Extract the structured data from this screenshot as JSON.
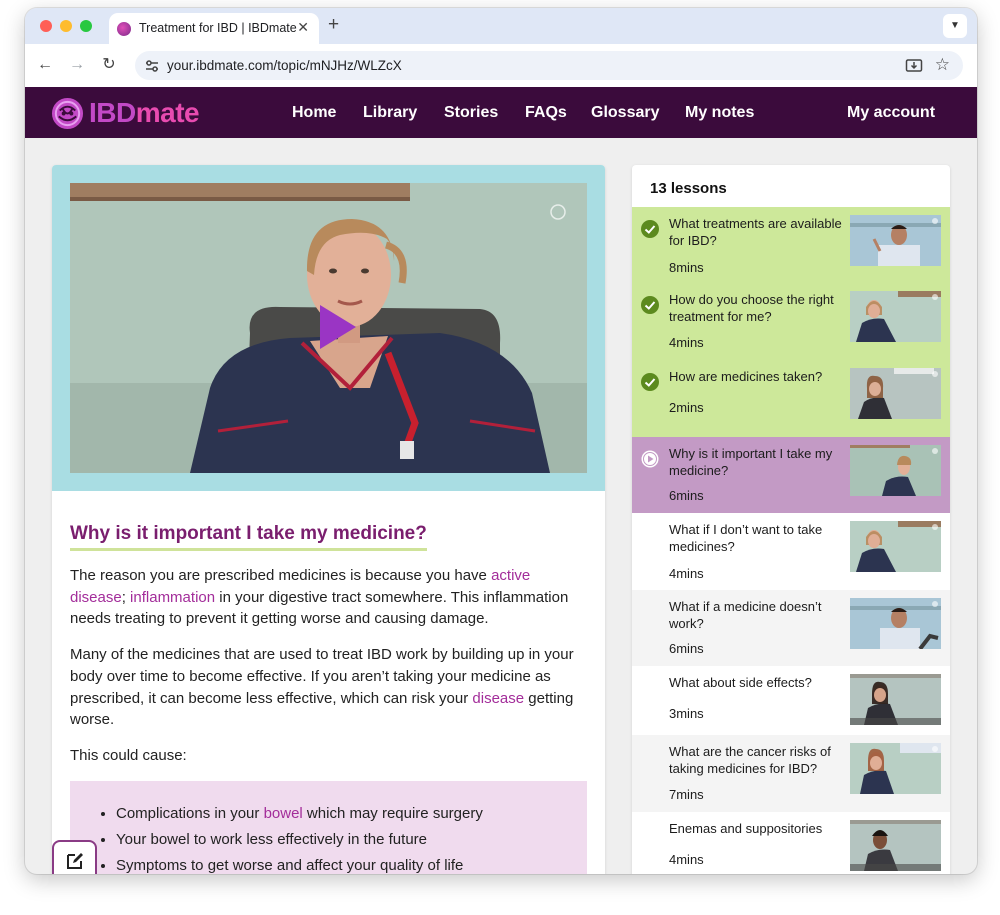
{
  "browser": {
    "tab_title": "Treatment for IBD | IBDmate",
    "url": "your.ibdmate.com/topic/mNJHz/WLZcX"
  },
  "site": {
    "logo_prefix": "IBD",
    "logo_suffix": "mate",
    "nav": [
      {
        "label": "Home"
      },
      {
        "label": "Library"
      },
      {
        "label": "Stories"
      },
      {
        "label": "FAQs"
      },
      {
        "label": "Glossary"
      },
      {
        "label": "My notes"
      }
    ],
    "account_label": "My account"
  },
  "article": {
    "title": "Why is it important I take my medicine?",
    "p1_a": "The reason you are prescribed medicines is because you have ",
    "p1_link1": "active disease",
    "p1_b": "; ",
    "p1_link2": "inflammation",
    "p1_c": " in your digestive tract somewhere. This inflammation needs treating to prevent it getting worse and causing damage.",
    "p2_a": "Many of the medicines that are used to treat IBD work by building up in your body over time to become effective. If you aren’t taking your medicine as prescribed, it can become less effective, which can risk your ",
    "p2_link": "disease",
    "p2_b": " getting worse.",
    "p3": "This could cause:",
    "b1_a": "Complications in your ",
    "b1_link": "bowel",
    "b1_b": " which may require surgery",
    "b2": "Your bowel to work less effectively in the future",
    "b3": "Symptoms to get worse and affect your quality of life"
  },
  "lessons": {
    "count_label": "13 lessons",
    "items": [
      {
        "title": "What treatments are available for IBD?",
        "duration": "8mins",
        "status": "completed"
      },
      {
        "title": "How do you choose the right treatment for me?",
        "duration": "4mins",
        "status": "completed"
      },
      {
        "title": "How are medicines taken?",
        "duration": "2mins",
        "status": "completed"
      },
      {
        "title": "Why is it important I take my medicine?",
        "duration": "6mins",
        "status": "current"
      },
      {
        "title": "What if I don’t want to take medicines?",
        "duration": "4mins",
        "status": "none"
      },
      {
        "title": "What if a medicine doesn’t work?",
        "duration": "6mins",
        "status": "none"
      },
      {
        "title": "What about side effects?",
        "duration": "3mins",
        "status": "none"
      },
      {
        "title": "What are the cancer risks of taking medicines for IBD?",
        "duration": "7mins",
        "status": "none"
      },
      {
        "title": "Enemas and suppositories",
        "duration": "4mins",
        "status": "none"
      }
    ]
  },
  "colors": {
    "header_bg": "#3b0b3c",
    "brand_pink": "#e84bb0",
    "completed_bg": "#cde89a",
    "current_bg": "#c39ac5",
    "link": "#a32d9a",
    "title": "#7a1e6e",
    "play_button": "#9a35c4",
    "callout_bg": "#f0dbee"
  }
}
